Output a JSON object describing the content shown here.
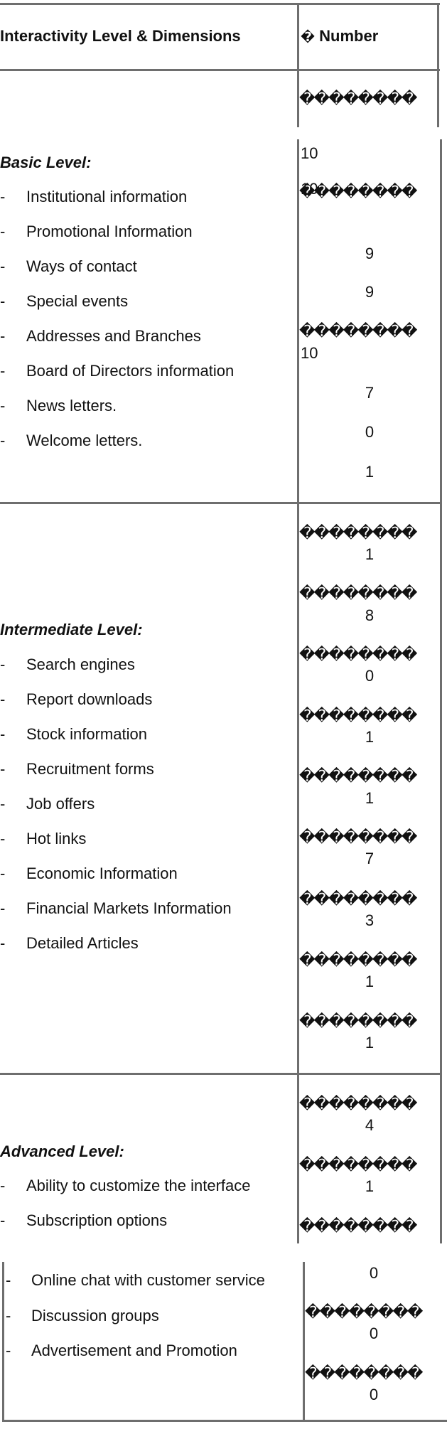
{
  "table": {
    "header": {
      "col1": "Interactivity Level & Dimensions",
      "col2_prefix": "�",
      "col2": "Number"
    },
    "garbled": "��������",
    "dash": "-",
    "basic": {
      "title": "Basic Level:",
      "items": [
        "Institutional information",
        "Promotional Information",
        "Ways of contact",
        "Special events",
        "Addresses and Branches",
        "Board of Directors information",
        "News letters.",
        "Welcome letters."
      ],
      "numbers": [
        "10",
        "10",
        "9",
        "9",
        "10",
        "7",
        "0",
        "1"
      ]
    },
    "intermediate": {
      "title": "Intermediate Level:",
      "items": [
        "Search engines",
        "Report downloads",
        "Stock information",
        "Recruitment forms",
        "Job offers",
        "Hot links",
        "Economic Information",
        "Financial Markets Information",
        "Detailed Articles"
      ],
      "numbers": [
        "1",
        "8",
        "0",
        "1",
        "1",
        "7",
        "3",
        "1",
        "1"
      ]
    },
    "advanced": {
      "title": "Advanced Level:",
      "items": [
        "Ability to customize the interface",
        "Subscription options",
        "Online chat with customer service",
        "Discussion groups",
        "Advertisement and Promotion"
      ],
      "numbers": [
        "4",
        "1",
        "0",
        "0",
        "0"
      ]
    }
  }
}
